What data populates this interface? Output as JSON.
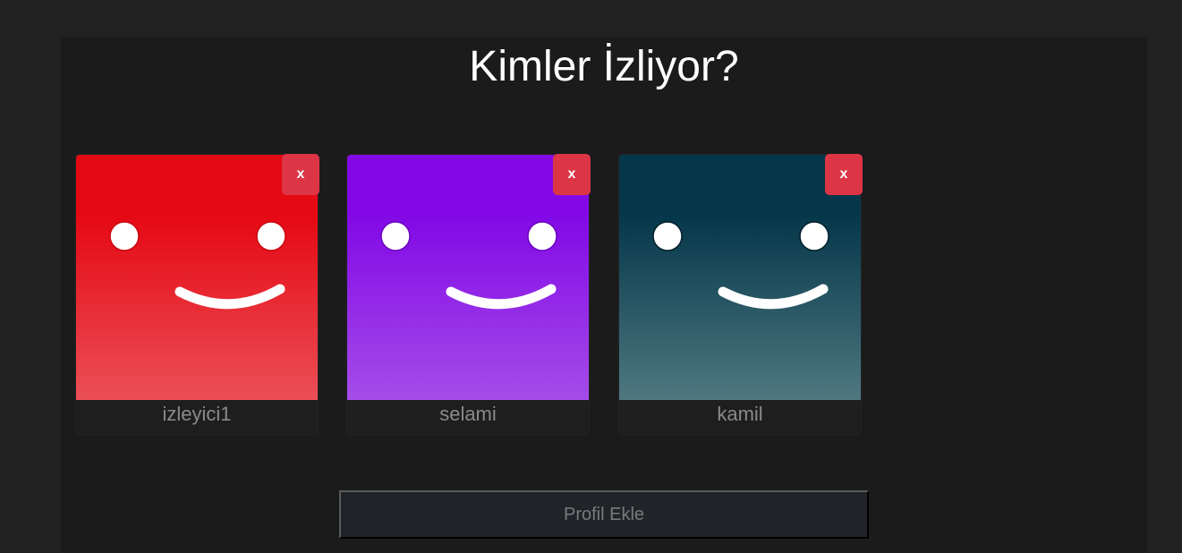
{
  "page": {
    "title": "Kimler İzliyor?"
  },
  "profiles": [
    {
      "name": "izleyici1",
      "delete_label": "x",
      "color_top": "#e50914",
      "color_bottom": "#eb4f57",
      "face_color": "#ffffff",
      "face_stroke": "#e50914"
    },
    {
      "name": "selami",
      "delete_label": "x",
      "color_top": "#8209e6",
      "color_bottom": "#a54ce8",
      "face_color": "#ffffff",
      "face_stroke": "#8209e6"
    },
    {
      "name": "kamil",
      "delete_label": "x",
      "color_top": "#05374a",
      "color_bottom": "#4f7880",
      "face_color": "#ffffff",
      "face_stroke": "#05374a"
    }
  ],
  "actions": {
    "add_profile_label": "Profil Ekle"
  },
  "colors": {
    "background": "#222222",
    "panel": "#1b1b1b",
    "delete_button": "#dc3545"
  }
}
